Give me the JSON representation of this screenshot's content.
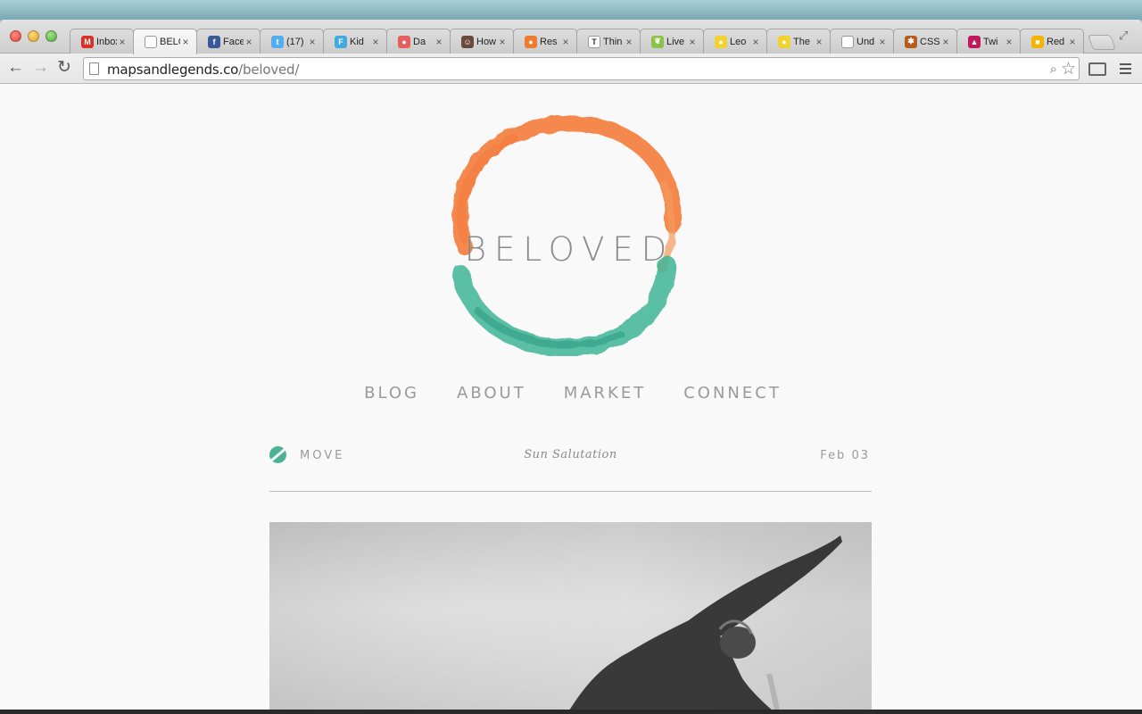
{
  "browser": {
    "tabs": [
      {
        "title": "Inbox",
        "favicon": "gmail-icon",
        "color": "#d93025",
        "glyph": "M"
      },
      {
        "title": "BELOVED",
        "favicon": "page-icon",
        "color": "#ffffff",
        "glyph": ""
      },
      {
        "title": "Facebook",
        "favicon": "facebook-icon",
        "color": "#3b5998",
        "glyph": "f"
      },
      {
        "title": "(17)",
        "favicon": "twitter-icon",
        "color": "#55acee",
        "glyph": "t"
      },
      {
        "title": "Kid",
        "favicon": "f-circle-icon",
        "color": "#3fa9e0",
        "glyph": "F"
      },
      {
        "title": "Da",
        "favicon": "pie-icon",
        "color": "#e85d5d",
        "glyph": "●"
      },
      {
        "title": "How",
        "favicon": "avatar-icon",
        "color": "#6b4a3a",
        "glyph": "☺"
      },
      {
        "title": "Res",
        "favicon": "orange-circle-icon",
        "color": "#f07b2f",
        "glyph": "●"
      },
      {
        "title": "Thin",
        "favicon": "t-logo-icon",
        "color": "#ffffff",
        "glyph": "T"
      },
      {
        "title": "Live",
        "favicon": "leaf-icon",
        "color": "#8bc34a",
        "glyph": "❦"
      },
      {
        "title": "Leo",
        "favicon": "yellow-badge-icon",
        "color": "#f2d22e",
        "glyph": "●"
      },
      {
        "title": "The",
        "favicon": "yellow-badge-icon",
        "color": "#f2d22e",
        "glyph": "●"
      },
      {
        "title": "Und",
        "favicon": "page-icon",
        "color": "#ffffff",
        "glyph": ""
      },
      {
        "title": "CSS",
        "favicon": "asterisk-icon",
        "color": "#b85c1e",
        "glyph": "✱"
      },
      {
        "title": "Twi",
        "favicon": "triangle-icon",
        "color": "#c2185b",
        "glyph": "▲"
      },
      {
        "title": "Red",
        "favicon": "yellow-square-icon",
        "color": "#f4b400",
        "glyph": "■"
      }
    ],
    "url_host": "mapsandlegends.co",
    "url_path": "/beloved/"
  },
  "logo": {
    "text": "BELOVED",
    "ring_top_color": "#f47c3c",
    "ring_bottom_color": "#3fb597"
  },
  "nav": {
    "items": [
      "BLOG",
      "ABOUT",
      "MARKET",
      "CONNECT"
    ]
  },
  "post": {
    "category": "MOVE",
    "title": "Sun Salutation",
    "date": "Feb 03",
    "accent": "#4bb395"
  }
}
